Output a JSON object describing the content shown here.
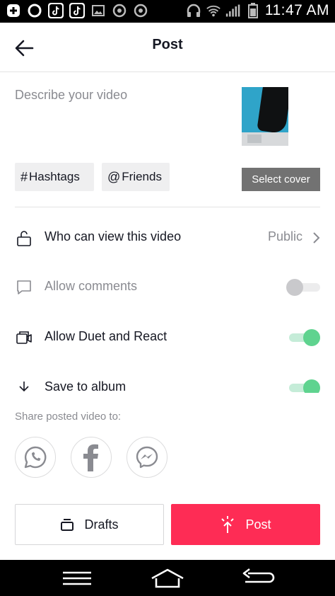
{
  "status_bar": {
    "time": "11:47 AM"
  },
  "header": {
    "title": "Post"
  },
  "description": {
    "placeholder": "Describe your video"
  },
  "chips": {
    "hashtags_symbol": "#",
    "hashtags_label": "Hashtags",
    "friends_symbol": "@",
    "friends_label": "Friends"
  },
  "select_cover_label": "Select cover",
  "settings": {
    "who_can_view": {
      "label": "Who can view this video",
      "value": "Public",
      "icon": "lock-icon"
    },
    "allow_comments": {
      "label": "Allow comments",
      "icon": "comment-icon",
      "enabled": false
    },
    "allow_duet": {
      "label": "Allow Duet and React",
      "icon": "duet-icon",
      "enabled": true
    },
    "save_album": {
      "label": "Save to album",
      "icon": "download-icon",
      "enabled": true
    }
  },
  "share": {
    "label": "Share posted video to:",
    "targets": [
      "whatsapp-icon",
      "facebook-icon",
      "messenger-icon"
    ]
  },
  "buttons": {
    "drafts_label": "Drafts",
    "post_label": "Post"
  },
  "colors": {
    "post_accent": "#fe2c55",
    "toggle_on": "#5fd38f",
    "muted_text": "#8a8b91"
  }
}
